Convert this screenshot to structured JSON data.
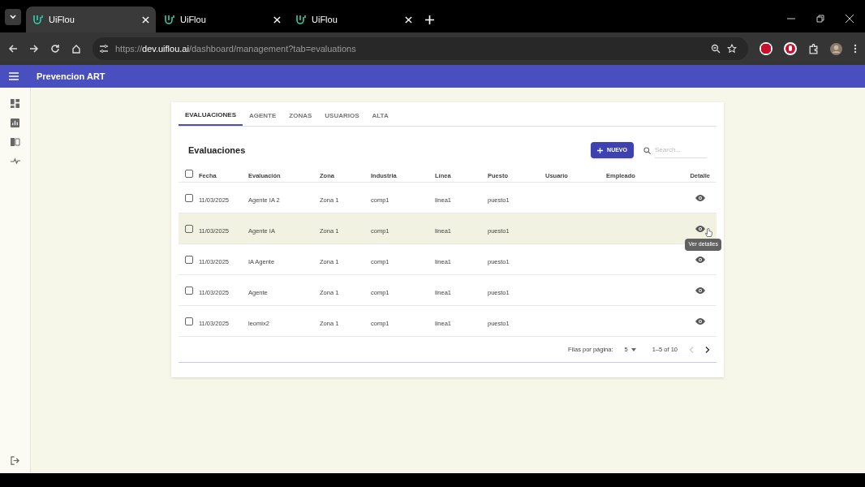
{
  "browser": {
    "tabs": [
      {
        "title": "UiFlou",
        "selected": true
      },
      {
        "title": "UiFlou",
        "selected": false
      },
      {
        "title": "UiFlou",
        "selected": false
      }
    ],
    "url": {
      "scheme": "https://",
      "host": "dev.uiflou.ai",
      "path": "/dashboard/management?tab=evaluations"
    }
  },
  "app_bar": {
    "title": "Prevencion ART"
  },
  "tabs": [
    {
      "label": "EVALUACIONES",
      "selected": true
    },
    {
      "label": "AGENTE",
      "selected": false
    },
    {
      "label": "ZONAS",
      "selected": false
    },
    {
      "label": "USUARIOS",
      "selected": false
    },
    {
      "label": "ALTA",
      "selected": false
    }
  ],
  "table": {
    "title": "Evaluaciones",
    "new_button": "NUEVO",
    "search": {
      "placeholder": "Search..."
    },
    "select_all": {
      "checked": false
    },
    "columns": [
      "Fecha",
      "Evaluación",
      "Zona",
      "Industria",
      "Línea",
      "Puesto",
      "Usuario",
      "Empleado",
      "Detalle"
    ],
    "rows": [
      {
        "checked": false,
        "highlighted": false,
        "cells": [
          "11/03/2025",
          "Agente IA 2",
          "Zona 1",
          "comp1",
          "linea1",
          "puesto1",
          "",
          ""
        ]
      },
      {
        "checked": false,
        "highlighted": true,
        "tooltip": "Ver detalles",
        "cells": [
          "11/03/2025",
          "Agente IA",
          "Zona 1",
          "comp1",
          "linea1",
          "puesto1",
          "",
          ""
        ]
      },
      {
        "checked": false,
        "highlighted": false,
        "cells": [
          "11/03/2025",
          "IA Agente",
          "Zona 1",
          "comp1",
          "linea1",
          "puesto1",
          "",
          ""
        ]
      },
      {
        "checked": false,
        "highlighted": false,
        "cells": [
          "11/03/2025",
          "Agente",
          "Zona 1",
          "comp1",
          "linea1",
          "puesto1",
          "",
          ""
        ]
      },
      {
        "checked": false,
        "highlighted": false,
        "cells": [
          "11/03/2025",
          "leomix2",
          "Zona 1",
          "comp1",
          "linea1",
          "puesto1",
          "",
          ""
        ]
      }
    ],
    "pagination": {
      "rows_label": "Filas por página:",
      "rows_per_page": "5",
      "range": "1–5 of 10",
      "prev_disabled": true,
      "next_disabled": false
    }
  }
}
